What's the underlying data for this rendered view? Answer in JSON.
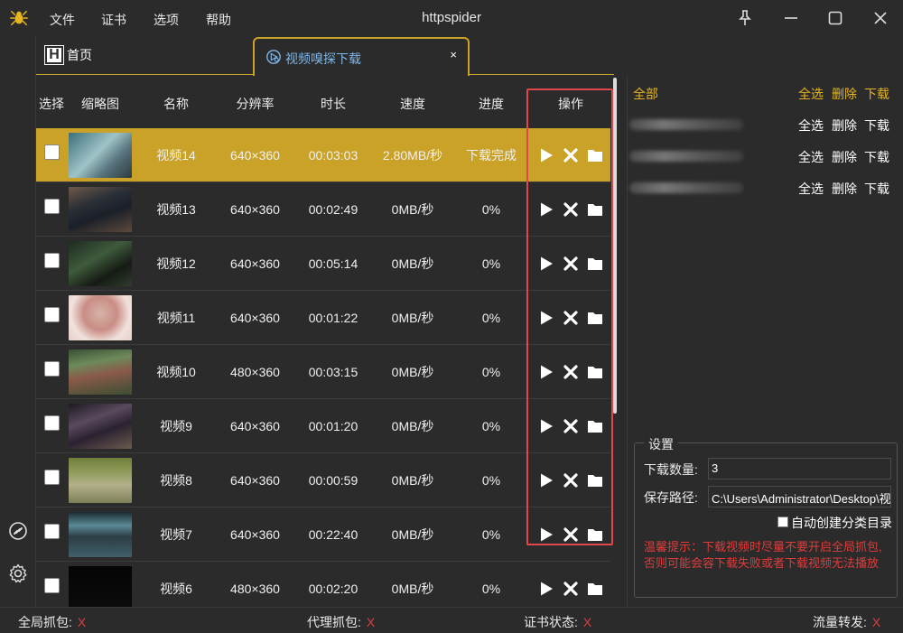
{
  "app": {
    "title": "httpspider",
    "menu": [
      "文件",
      "证书",
      "选项",
      "帮助"
    ]
  },
  "tabs": {
    "home_label": "首页",
    "home_logo": "H",
    "video_label": "视频嗅探下载",
    "close_glyph": "×"
  },
  "table": {
    "headers": [
      "选择",
      "缩略图",
      "名称",
      "分辨率",
      "时长",
      "速度",
      "进度",
      "操作"
    ],
    "rows": [
      {
        "name": "视频14",
        "res": "640×360",
        "dur": "00:03:03",
        "speed": "2.80MB/秒",
        "progress": "下载完成",
        "active": true
      },
      {
        "name": "视频13",
        "res": "640×360",
        "dur": "00:02:49",
        "speed": "0MB/秒",
        "progress": "0%",
        "active": false
      },
      {
        "name": "视频12",
        "res": "640×360",
        "dur": "00:05:14",
        "speed": "0MB/秒",
        "progress": "0%",
        "active": false
      },
      {
        "name": "视频11",
        "res": "640×360",
        "dur": "00:01:22",
        "speed": "0MB/秒",
        "progress": "0%",
        "active": false
      },
      {
        "name": "视频10",
        "res": "480×360",
        "dur": "00:03:15",
        "speed": "0MB/秒",
        "progress": "0%",
        "active": false
      },
      {
        "name": "视频9",
        "res": "640×360",
        "dur": "00:01:20",
        "speed": "0MB/秒",
        "progress": "0%",
        "active": false
      },
      {
        "name": "视频8",
        "res": "640×360",
        "dur": "00:00:59",
        "speed": "0MB/秒",
        "progress": "0%",
        "active": false
      },
      {
        "name": "视频7",
        "res": "640×360",
        "dur": "00:22:40",
        "speed": "0MB/秒",
        "progress": "0%",
        "active": false
      },
      {
        "name": "视频6",
        "res": "480×360",
        "dur": "00:02:20",
        "speed": "0MB/秒",
        "progress": "0%",
        "active": false
      }
    ]
  },
  "right_panel": {
    "groups": [
      {
        "name": "全部",
        "blurred": false
      },
      {
        "name": "",
        "blurred": true
      },
      {
        "name": "",
        "blurred": true
      },
      {
        "name": "",
        "blurred": true
      }
    ],
    "select_all": "全选",
    "delete": "删除",
    "download": "下载"
  },
  "settings": {
    "legend": "设置",
    "count_label": "下载数量:",
    "count_value": "3",
    "path_label": "保存路径:",
    "path_value": "C:\\Users\\Administrator\\Desktop\\视",
    "auto_label": "自动创建分类目录",
    "tip": "温馨提示：下载视频时尽量不要开启全局抓包,否则可能会容下载失败或者下载视频无法播放"
  },
  "status": {
    "global": "全局抓包:",
    "proxy": "代理抓包:",
    "cert": "证书状态:",
    "forward": "流量转发:",
    "off": "X"
  },
  "colors": {
    "accent": "#c9a227",
    "highlight": "#e0474a",
    "tab_text": "#7eb7ea",
    "error": "#e03b3b"
  },
  "icons": {
    "play": "play-icon",
    "delete": "close-icon",
    "folder": "folder-icon"
  }
}
